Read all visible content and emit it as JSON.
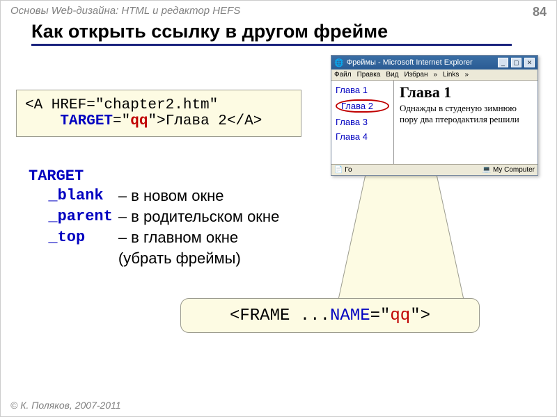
{
  "header": {
    "breadcrumb": "Основы Web-дизайна: HTML и редактор HEFS",
    "page_number": "84"
  },
  "title": "Как открыть ссылку в другом фрейме",
  "code": {
    "lt1": "<A HREF=\"chapter2.htm\"",
    "target_kw": "TARGET",
    "eq": "=\"",
    "qq": "qq",
    "close": "\">Глава 2</A>"
  },
  "targets": {
    "heading": "TARGET",
    "rows": [
      {
        "kw": "_blank",
        "desc": "– в новом окне"
      },
      {
        "kw": "_parent",
        "desc": "– в родительском окне"
      },
      {
        "kw": "_top",
        "desc": "– в главном окне"
      },
      {
        "kw": "",
        "desc": "  (убрать фреймы)"
      }
    ]
  },
  "callout": {
    "p1": "<FRAME ... ",
    "kw": "NAME",
    "eq": "=\"",
    "qq": "qq",
    "p2": "\">"
  },
  "browser": {
    "title": "Фреймы - Microsoft Internet Explorer",
    "menu": [
      "Файл",
      "Правка",
      "Вид",
      "Избран",
      "»",
      "Links",
      "»"
    ],
    "nav": [
      "Глава 1",
      "Глава 2",
      "Глава 3",
      "Глава 4"
    ],
    "content_heading": "Глава 1",
    "content_text": "Однажды в студеную зимнюю пору два птеродактиля решили",
    "status_left": "Го",
    "status_right": "My Computer"
  },
  "footer": "© К. Поляков, 2007-2011"
}
